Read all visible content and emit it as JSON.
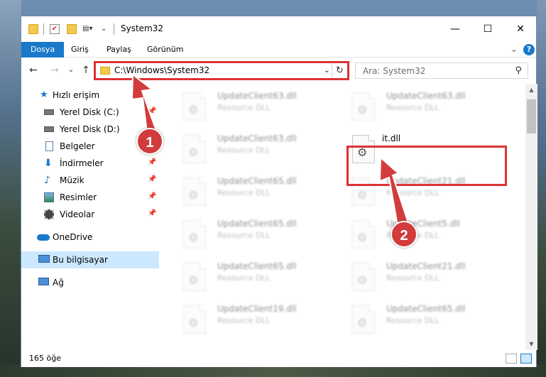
{
  "window": {
    "title": "System32",
    "controls": {
      "minimize": "—",
      "maximize": "☐",
      "close": "✕"
    }
  },
  "ribbon": {
    "tabs": [
      {
        "label": "Dosya"
      },
      {
        "label": "Giriş"
      },
      {
        "label": "Paylaş"
      },
      {
        "label": "Görünüm"
      }
    ],
    "help": "?",
    "expand": "⌄"
  },
  "navigation": {
    "back": "←",
    "forward": "→",
    "recent": "⌄",
    "up": "↑",
    "address": "C:\\Windows\\System32",
    "address_dropdown": "⌄",
    "refresh": "↻",
    "search_placeholder": "Ara: System32",
    "search_icon": "⚲"
  },
  "sidebar": {
    "items": [
      {
        "label": "Hızlı erişim",
        "icon": "star-icon"
      },
      {
        "label": "Yerel Disk (C:)",
        "icon": "drive-icon",
        "pinned": true
      },
      {
        "label": "Yerel Disk (D:)",
        "icon": "drive-icon",
        "pinned": false
      },
      {
        "label": "Belgeler",
        "icon": "documents-icon",
        "pinned": true
      },
      {
        "label": "İndirmeler",
        "icon": "downloads-icon",
        "pinned": true
      },
      {
        "label": "Müzik",
        "icon": "music-icon",
        "pinned": true
      },
      {
        "label": "Resimler",
        "icon": "pictures-icon",
        "pinned": true
      },
      {
        "label": "Videolar",
        "icon": "videos-icon",
        "pinned": true
      },
      {
        "label": "OneDrive",
        "icon": "onedrive-icon"
      },
      {
        "label": "Bu bilgisayar",
        "icon": "computer-icon",
        "selected": true
      },
      {
        "label": "Ağ",
        "icon": "network-icon"
      }
    ],
    "pin_glyph": "📌"
  },
  "files": {
    "left_column": [
      {
        "name": "UpdateClient63.dll",
        "type": "Resource DLL"
      },
      {
        "name": "UpdateClient63.dll",
        "type": "Resource DLL"
      },
      {
        "name": "UpdateClient65.dll",
        "type": "Resource DLL"
      },
      {
        "name": "UpdateClient65.dll",
        "type": "Resource DLL"
      },
      {
        "name": "UpdateClient65.dll",
        "type": "Resource DLL"
      },
      {
        "name": "UpdateClient19.dll",
        "type": "Resource DLL"
      }
    ],
    "right_column": [
      {
        "name": "UpdateClient63.dll",
        "type": "Resource DLL"
      },
      {
        "name": "it.dll",
        "type": "",
        "highlighted": true
      },
      {
        "name": "UpdateClient21.dll",
        "type": "Resource DLL"
      },
      {
        "name": "UpdateClient5.dll",
        "type": "Resource DLL"
      },
      {
        "name": "UpdateClient21.dll",
        "type": "Resource DLL"
      },
      {
        "name": "UpdateClient65.dll",
        "type": "Resource DLL"
      }
    ]
  },
  "status": {
    "count": "165 öğe"
  },
  "annotations": {
    "step1": "1",
    "step2": "2",
    "color": "#d33a3a"
  }
}
